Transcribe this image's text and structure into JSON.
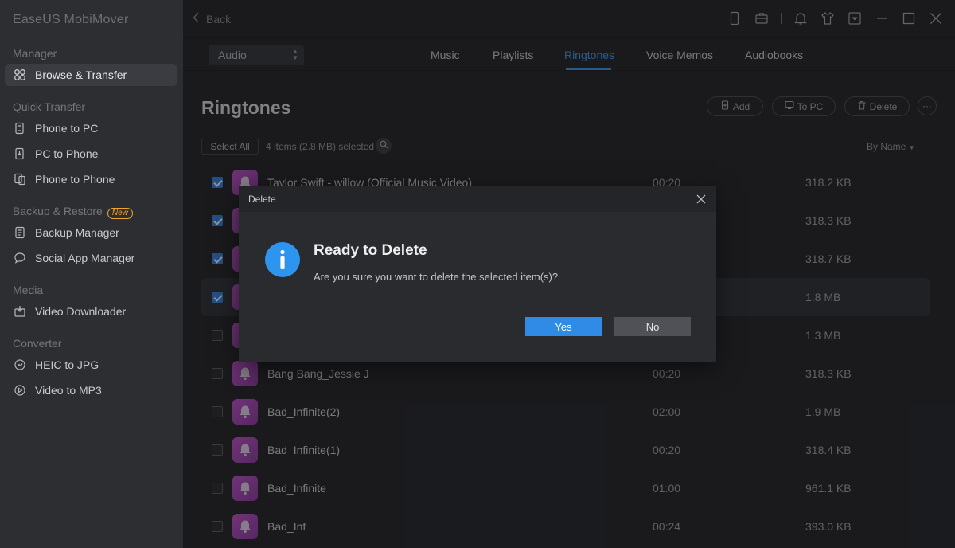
{
  "app": {
    "title": "EaseUS MobiMover"
  },
  "sidebar": {
    "sections": [
      {
        "label": "Manager",
        "items": [
          {
            "label": "Browse & Transfer",
            "icon": "grid-icon",
            "active": true
          }
        ]
      },
      {
        "label": "Quick Transfer",
        "items": [
          {
            "label": "Phone to PC",
            "icon": "phone-to-pc-icon"
          },
          {
            "label": "PC to Phone",
            "icon": "pc-to-phone-icon"
          },
          {
            "label": "Phone to Phone",
            "icon": "phone-to-phone-icon"
          }
        ]
      },
      {
        "label": "Backup & Restore",
        "badge": "New",
        "items": [
          {
            "label": "Backup Manager",
            "icon": "backup-icon"
          },
          {
            "label": "Social App Manager",
            "icon": "chat-icon"
          }
        ]
      },
      {
        "label": "Media",
        "items": [
          {
            "label": "Video Downloader",
            "icon": "download-icon"
          }
        ]
      },
      {
        "label": "Converter",
        "items": [
          {
            "label": "HEIC to JPG",
            "icon": "image-convert-icon"
          },
          {
            "label": "Video to MP3",
            "icon": "video-convert-icon"
          }
        ]
      }
    ]
  },
  "topbar": {
    "back_label": "Back"
  },
  "filter": {
    "selected": "Audio"
  },
  "tabs": [
    {
      "label": "Music"
    },
    {
      "label": "Playlists"
    },
    {
      "label": "Ringtones",
      "active": true
    },
    {
      "label": "Voice Memos"
    },
    {
      "label": "Audiobooks"
    }
  ],
  "main": {
    "title": "Ringtones",
    "actions": {
      "add": "Add",
      "to_pc": "To PC",
      "delete": "Delete",
      "more": "···"
    },
    "select_all": "Select All",
    "selection_info": "4 items (2.8 MB) selected",
    "sort_label": "By Name"
  },
  "rows": [
    {
      "name": "Taylor Swift - willow (Official Music Video)",
      "duration": "00:20",
      "size": "318.2 KB",
      "checked": true
    },
    {
      "name": "",
      "duration": "",
      "size": "318.3 KB",
      "checked": true
    },
    {
      "name": "",
      "duration": "",
      "size": "318.7 KB",
      "checked": true
    },
    {
      "name": "",
      "duration": "",
      "size": "1.8 MB",
      "checked": true
    },
    {
      "name": "",
      "duration": "",
      "size": "1.3 MB",
      "checked": false
    },
    {
      "name": "Bang Bang_Jessie J",
      "duration": "00:20",
      "size": "318.3 KB",
      "checked": false
    },
    {
      "name": "Bad_Infinite(2)",
      "duration": "02:00",
      "size": "1.9 MB",
      "checked": false
    },
    {
      "name": "Bad_Infinite(1)",
      "duration": "00:20",
      "size": "318.4 KB",
      "checked": false
    },
    {
      "name": "Bad_Infinite",
      "duration": "01:00",
      "size": "961.1 KB",
      "checked": false
    },
    {
      "name": "Bad_Inf",
      "duration": "00:24",
      "size": "393.0 KB",
      "checked": false
    }
  ],
  "dialog": {
    "header": "Delete",
    "title": "Ready to Delete",
    "message": "Are you sure you want to delete the selected item(s)?",
    "yes_label": "Yes",
    "no_label": "No"
  },
  "colors": {
    "accent": "#3d9bf1",
    "ringtone_thumb": "#b04bc0",
    "badge": "#f0a52e"
  }
}
